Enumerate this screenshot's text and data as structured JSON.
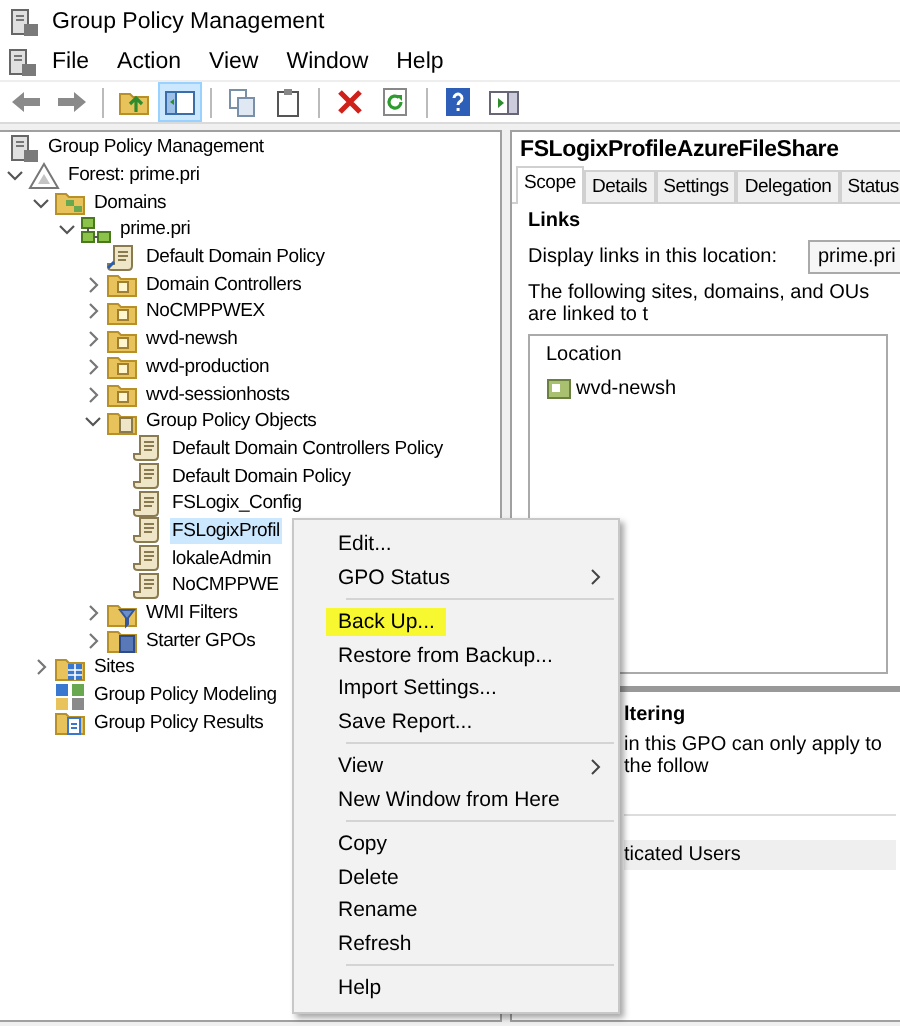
{
  "window": {
    "title": "Group Policy Management"
  },
  "menu_bar": [
    "File",
    "Action",
    "View",
    "Window",
    "Help"
  ],
  "toolbar": [
    {
      "kind": "back",
      "pressed": false
    },
    {
      "kind": "forward",
      "pressed": false
    },
    {
      "kind": "separator"
    },
    {
      "kind": "up",
      "pressed": false
    },
    {
      "kind": "tree",
      "pressed": true
    },
    {
      "kind": "separator"
    },
    {
      "kind": "copy",
      "pressed": false
    },
    {
      "kind": "paste",
      "pressed": false
    },
    {
      "kind": "separator"
    },
    {
      "kind": "delete",
      "pressed": false
    },
    {
      "kind": "refresh",
      "pressed": false
    },
    {
      "kind": "separator"
    },
    {
      "kind": "help",
      "pressed": false
    },
    {
      "kind": "actionpane",
      "pressed": false
    }
  ],
  "tree": {
    "label": "Group Policy Management",
    "kind": "console",
    "selected": false,
    "children": [
      {
        "label": "Forest: prime.pri",
        "kind": "forest",
        "selected": false,
        "expanded": true,
        "children": [
          {
            "label": "Domains",
            "kind": "domains",
            "selected": false,
            "expanded": true,
            "children": [
              {
                "label": "prime.pri",
                "kind": "domain",
                "selected": false,
                "expanded": true,
                "children": [
                  {
                    "label": "Default Domain Policy",
                    "kind": "link",
                    "selected": false
                  },
                  {
                    "label": "Domain Controllers",
                    "kind": "ou",
                    "selected": false,
                    "expanded": false
                  },
                  {
                    "label": "NoCMPPWEX",
                    "kind": "ou",
                    "selected": false,
                    "expanded": false
                  },
                  {
                    "label": "wvd-newsh",
                    "kind": "ou",
                    "selected": false,
                    "expanded": false
                  },
                  {
                    "label": "wvd-production",
                    "kind": "ou",
                    "selected": false,
                    "expanded": false
                  },
                  {
                    "label": "wvd-sessionhosts",
                    "kind": "ou",
                    "selected": false,
                    "expanded": false
                  },
                  {
                    "label": "Group Policy Objects",
                    "kind": "container",
                    "selected": false,
                    "expanded": true,
                    "children": [
                      {
                        "label": "Default Domain Controllers Policy",
                        "kind": "gpo",
                        "selected": false
                      },
                      {
                        "label": "Default Domain Policy",
                        "kind": "gpo",
                        "selected": false
                      },
                      {
                        "label": "FSLogix_Config",
                        "kind": "gpo",
                        "selected": false
                      },
                      {
                        "label": "FSLogixProfil",
                        "kind": "gpo",
                        "selected": true
                      },
                      {
                        "label": "lokaleAdmin",
                        "kind": "gpo",
                        "selected": false
                      },
                      {
                        "label": "NoCMPPWE",
                        "kind": "gpo",
                        "selected": false
                      }
                    ]
                  },
                  {
                    "label": "WMI Filters",
                    "kind": "wmi",
                    "selected": false,
                    "expanded": false
                  },
                  {
                    "label": "Starter GPOs",
                    "kind": "starter",
                    "selected": false,
                    "expanded": false
                  }
                ]
              }
            ]
          },
          {
            "label": "Sites",
            "kind": "sites",
            "selected": false,
            "expanded": false
          },
          {
            "label": "Group Policy Modeling",
            "kind": "modeling",
            "selected": false
          },
          {
            "label": "Group Policy Results",
            "kind": "results",
            "selected": false
          }
        ]
      }
    ]
  },
  "details": {
    "title": "FSLogixProfileAzureFileShare",
    "tabs": [
      {
        "label": "Scope",
        "selected": true
      },
      {
        "label": "Details",
        "selected": false
      },
      {
        "label": "Settings",
        "selected": false
      },
      {
        "label": "Delegation",
        "selected": false
      },
      {
        "label": "Status",
        "selected": false
      }
    ],
    "links": {
      "heading": "Links",
      "location_label": "Display links in this location:",
      "location_value": "prime.pri",
      "description": "The following sites, domains, and OUs are linked to t",
      "column": "Location",
      "rows": [
        "wvd-newsh"
      ]
    },
    "filtering": {
      "heading": "ltering",
      "description": "in this GPO can only apply to the follow",
      "rows": [
        "ticated Users"
      ]
    }
  },
  "context_menu": [
    {
      "kind": "item",
      "label": "Edit...",
      "submenu": false,
      "highlighted": false
    },
    {
      "kind": "item",
      "label": "GPO Status",
      "submenu": true,
      "highlighted": false
    },
    {
      "kind": "separator"
    },
    {
      "kind": "item",
      "label": "Back Up...",
      "submenu": false,
      "highlighted": true
    },
    {
      "kind": "item",
      "label": "Restore from Backup...",
      "submenu": false,
      "highlighted": false
    },
    {
      "kind": "item",
      "label": "Import Settings...",
      "submenu": false,
      "highlighted": false
    },
    {
      "kind": "item",
      "label": "Save Report...",
      "submenu": false,
      "highlighted": false
    },
    {
      "kind": "separator"
    },
    {
      "kind": "item",
      "label": "View",
      "submenu": true,
      "highlighted": false
    },
    {
      "kind": "item",
      "label": "New Window from Here",
      "submenu": false,
      "highlighted": false
    },
    {
      "kind": "separator"
    },
    {
      "kind": "item",
      "label": "Copy",
      "submenu": false,
      "highlighted": false
    },
    {
      "kind": "item",
      "label": "Delete",
      "submenu": false,
      "highlighted": false
    },
    {
      "kind": "item",
      "label": "Rename",
      "submenu": false,
      "highlighted": false
    },
    {
      "kind": "item",
      "label": "Refresh",
      "submenu": false,
      "highlighted": false
    },
    {
      "kind": "separator"
    },
    {
      "kind": "item",
      "label": "Help",
      "submenu": false,
      "highlighted": false
    }
  ]
}
